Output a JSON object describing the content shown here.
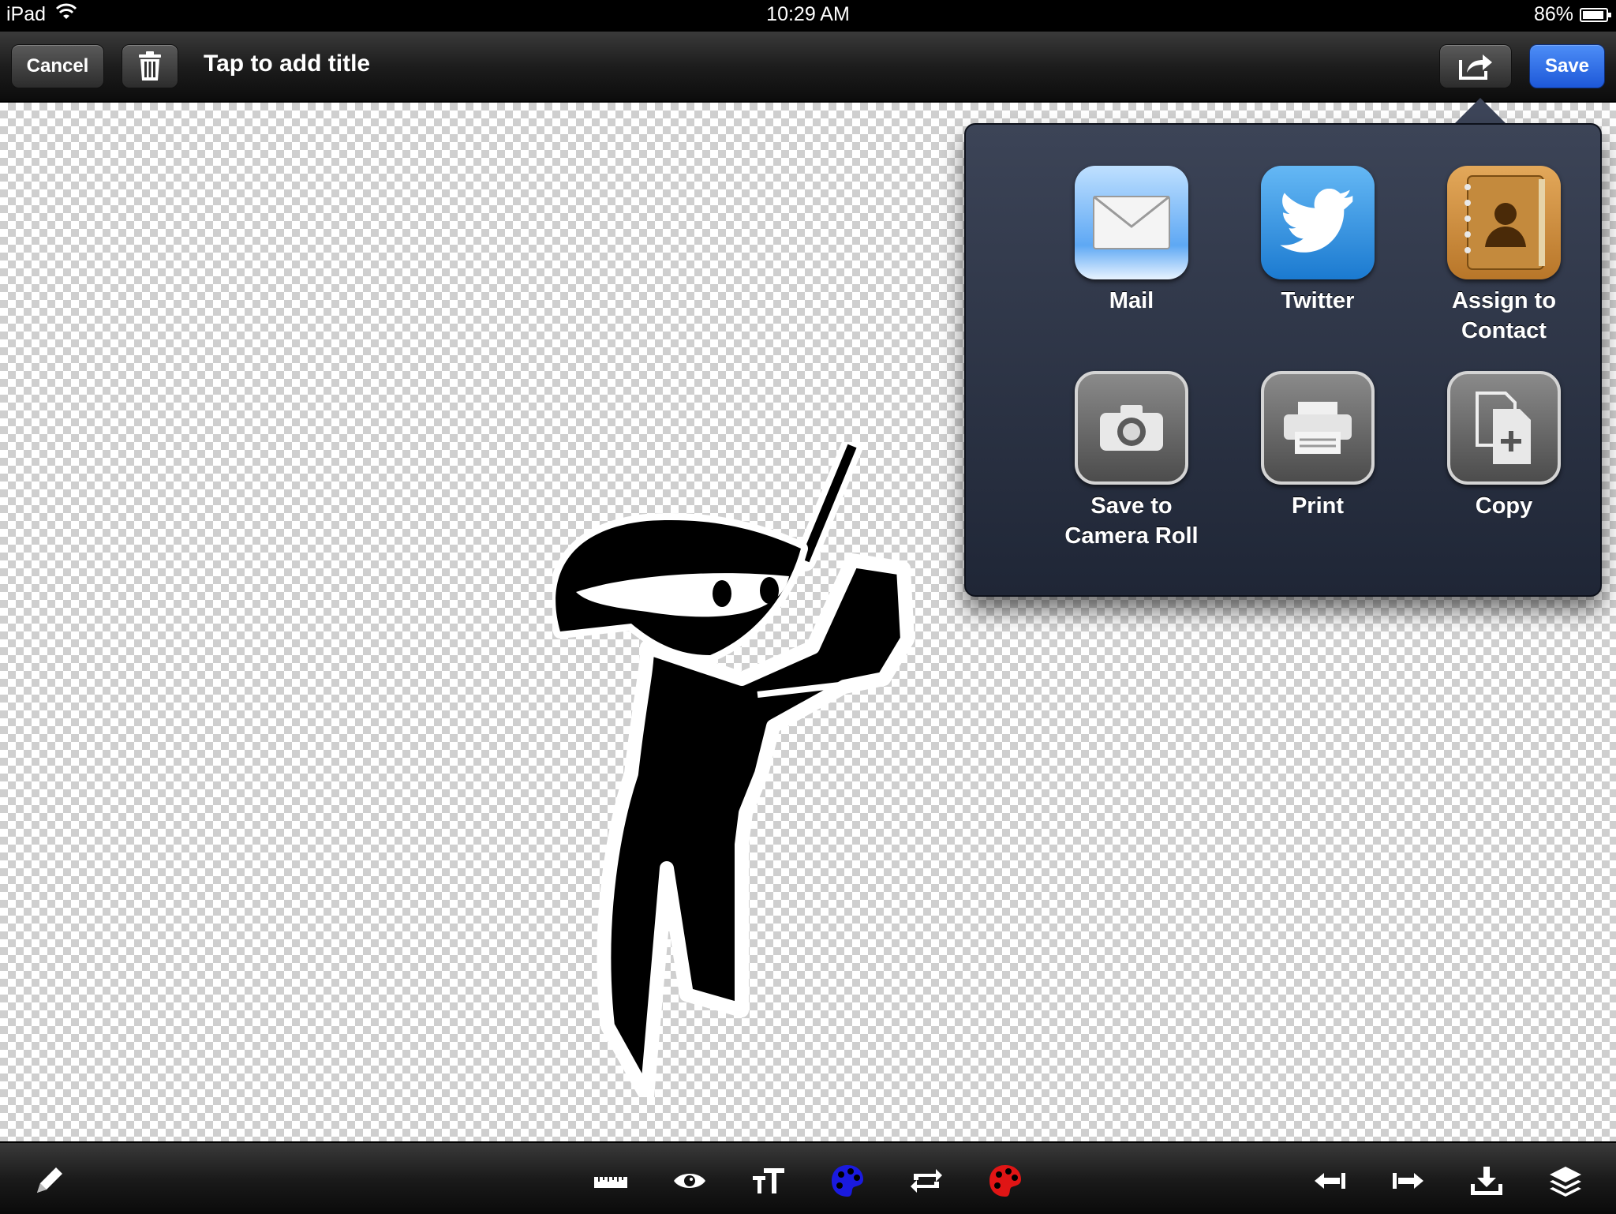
{
  "status_bar": {
    "device": "iPad",
    "time": "10:29 AM",
    "battery": "86%"
  },
  "toolbar": {
    "cancel_label": "Cancel",
    "title_placeholder": "Tap to add title",
    "save_label": "Save"
  },
  "share_sheet": {
    "items": [
      {
        "label": "Mail",
        "icon": "mail-icon"
      },
      {
        "label": "Twitter",
        "icon": "twitter-icon"
      },
      {
        "label": "Assign to\nContact",
        "icon": "contacts-icon"
      },
      {
        "label": "Save to\nCamera Roll",
        "icon": "camera-icon"
      },
      {
        "label": "Print",
        "icon": "printer-icon"
      },
      {
        "label": "Copy",
        "icon": "copy-icon"
      }
    ]
  },
  "bottom_tools": [
    "pencil-icon",
    "ruler-icon",
    "eye-icon",
    "text-size-icon",
    "blue-palette-icon",
    "flip-icon",
    "red-palette-icon",
    "undo-icon",
    "redo-icon",
    "download-icon",
    "layers-icon"
  ],
  "colors": {
    "save_button": "#1d58d8",
    "palette_blue": "#1a1adf",
    "palette_red": "#e01515"
  }
}
